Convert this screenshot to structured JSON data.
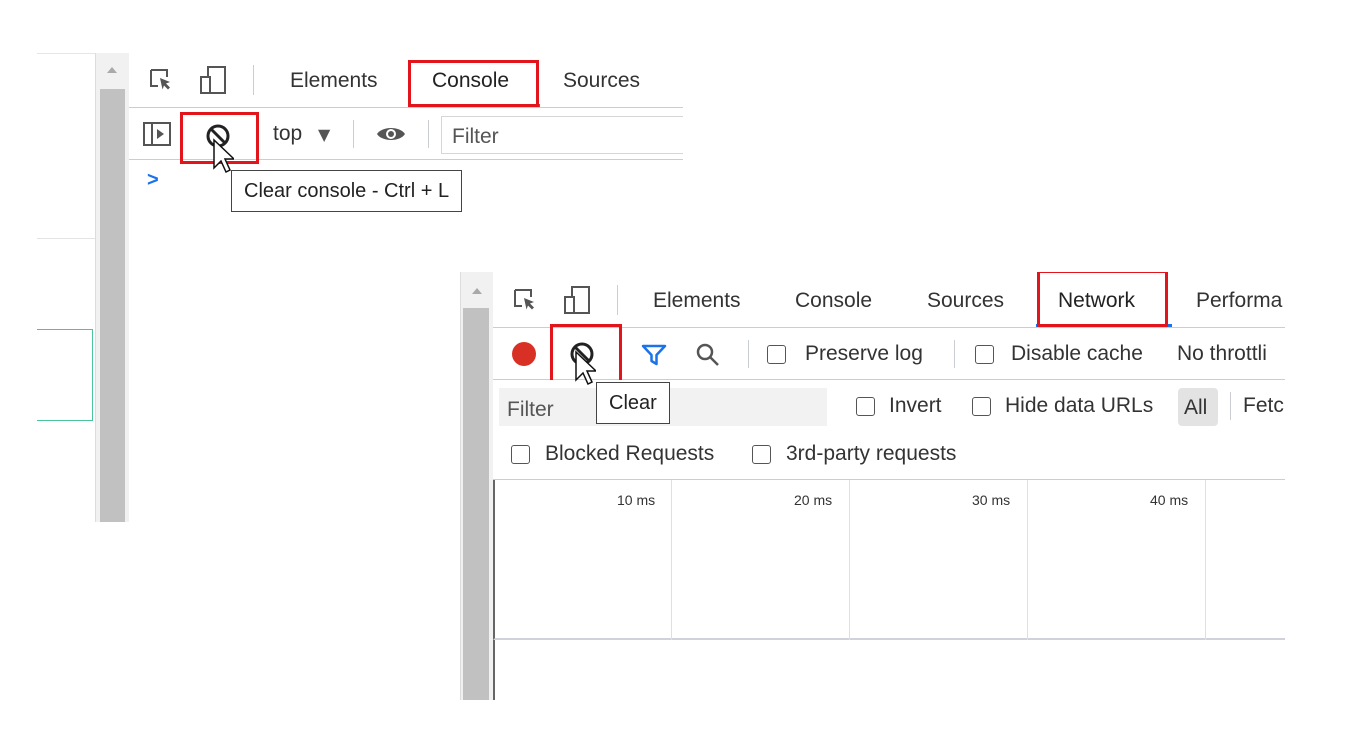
{
  "console_panel": {
    "tabs": [
      "Elements",
      "Console",
      "Sources"
    ],
    "active_tab": "Console",
    "context_label": "top",
    "filter_placeholder": "Filter",
    "prompt_glyph": ">",
    "tooltip": "Clear console - Ctrl + L"
  },
  "network_panel": {
    "tabs": [
      "Elements",
      "Console",
      "Sources",
      "Network",
      "Performa"
    ],
    "active_tab": "Network",
    "preserve_log_label": "Preserve log",
    "disable_cache_label": "Disable cache",
    "throttling_label": "No throttli",
    "filter_placeholder": "Filter",
    "tooltip": "Clear",
    "invert_label": "Invert",
    "hide_data_urls_label": "Hide data URLs",
    "type_filters": [
      "All",
      "Fetc"
    ],
    "blocked_requests_label": "Blocked Requests",
    "third_party_label": "3rd-party requests",
    "timeline_ticks": [
      "10 ms",
      "20 ms",
      "30 ms",
      "40 ms"
    ]
  },
  "colors": {
    "highlight": "#e2151c",
    "active_tab_underline": "#1a73e8",
    "record": "#d93025",
    "filter_funnel": "#1a73e8"
  },
  "icons": [
    "inspect-element-icon",
    "device-toolbar-icon",
    "sidebar-toggle-icon",
    "clear-icon",
    "eye-icon",
    "record-icon",
    "filter-funnel-icon",
    "search-icon",
    "mouse-cursor-icon"
  ]
}
